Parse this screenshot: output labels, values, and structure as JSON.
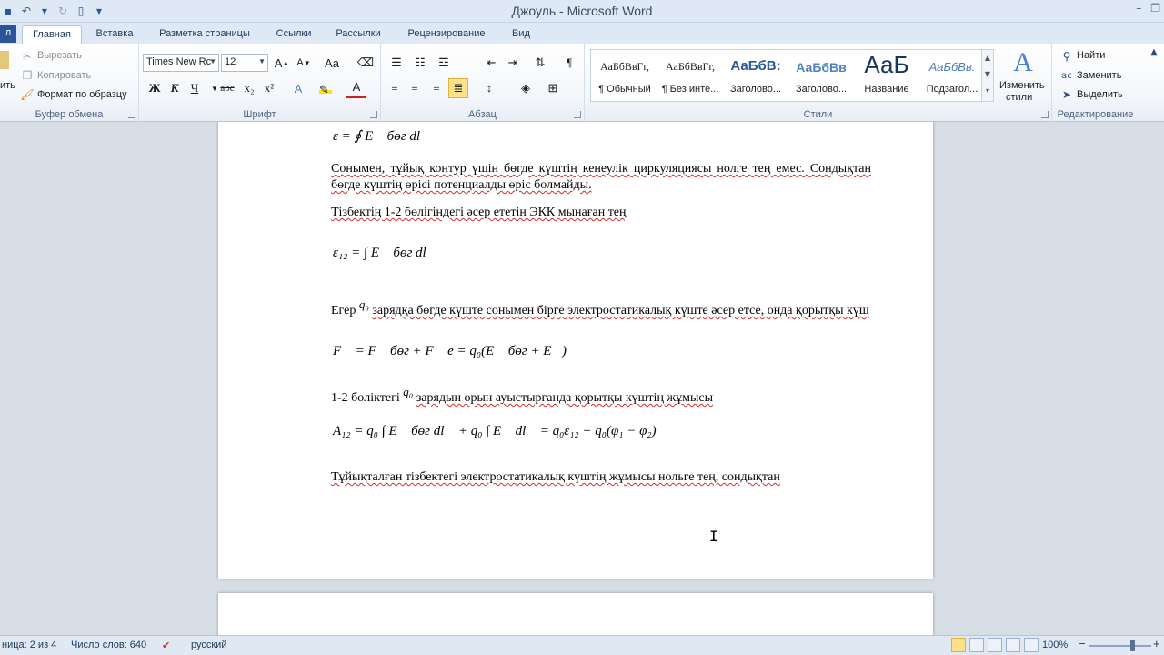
{
  "window": {
    "title": "Джоуль - Microsoft Word",
    "minimize_icon": "–",
    "restore_icon": "❐"
  },
  "tabs": [
    {
      "label": "л"
    },
    {
      "label": "Главная"
    },
    {
      "label": "Вставка"
    },
    {
      "label": "Разметка страницы"
    },
    {
      "label": "Ссылки"
    },
    {
      "label": "Рассылки"
    },
    {
      "label": "Рецензирование"
    },
    {
      "label": "Вид"
    }
  ],
  "ribbon": {
    "clipboard": {
      "label": "Буфер обмена",
      "paste_fragment": "ить",
      "cut": "Вырезать",
      "copy": "Копировать",
      "format_painter": "Формат по образцу"
    },
    "font": {
      "label": "Шрифт",
      "font_name": "Times New Rc",
      "font_size": "12",
      "grow": "A",
      "shrink": "A",
      "case": "Aa",
      "bold": "Ж",
      "italic": "К",
      "underline": "Ч",
      "strike": "abc",
      "subscript": "x₂",
      "superscript": "x²",
      "effects": "A",
      "font_color": "A"
    },
    "paragraph": {
      "label": "Абзац",
      "pilcrow": "¶"
    },
    "styles": {
      "label": "Стили",
      "items": [
        {
          "sample": "АаБбВвГг,",
          "name": "¶ Обычный"
        },
        {
          "sample": "АаБбВвГг,",
          "name": "¶ Без инте..."
        },
        {
          "sample": "АаБбВ:",
          "name": "Заголово..."
        },
        {
          "sample": "АаБбВв",
          "name": "Заголово..."
        },
        {
          "sample": "АаБ",
          "name": "Название"
        },
        {
          "sample": "АаБбВв.",
          "name": "Подзагол..."
        }
      ],
      "change_styles_1": "Изменить",
      "change_styles_2": "стили",
      "change_icon_letter": "A"
    },
    "editing": {
      "label": "Редактирование",
      "find": "Найти",
      "replace": "Заменить",
      "select": "Выделить"
    }
  },
  "document": {
    "p1": "Сонымен, тұйық контур үшін бөгде күштің кенеулік циркуляциясы нолге тең емес. Сондықтан бөгде күштің өрісі потенциалды өріс болмайды.",
    "p2": "Тізбектің 1-2 бөлігіндегі әсер ететін ЭКК мынаған тең",
    "p3_a": "Егер",
    "p3_q": "q₀",
    "p3_b": "зарядқа бөгде күште сонымен бірге электростатикалық күште әсер етсе, онда қорытқы күш",
    "p4_a": "1-2 бөліктегі",
    "p4_q": "q₀",
    "p4_b": "зарядын орын ауыстырғанда қорытқы күштің жұмысы",
    "p5": "Тұйықталған тізбектегі электростатикалық күштің жұмысы нольге тең, сондықтан",
    "f1": "ε = ∮ E⃗ бөг dl⃗",
    "f2": "ε₁₂ = ∫ E⃗ бөг dl⃗",
    "f3": "F⃗ = F⃗ бөг + F⃗ e = q₀(E⃗ бөг + E⃗)",
    "f4": "A₁₂ = q₀ ∫ E⃗ бөг dl⃗ + q₀ ∫ E⃗ dl⃗ = q₀ε₁₂ + q₀(φ₁ − φ₂)"
  },
  "statusbar": {
    "page": "ница: 2 из 4",
    "words": "Число слов: 640",
    "language": "русский",
    "zoom": "100%",
    "zoom_minus": "−",
    "zoom_plus": "+"
  }
}
